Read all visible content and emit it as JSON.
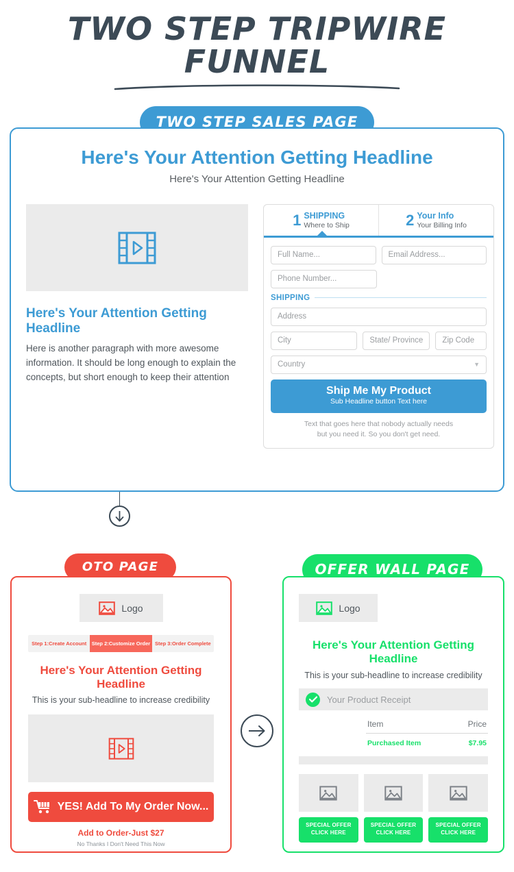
{
  "header": {
    "title": "TWO STEP TRIPWIRE FUNNEL",
    "badge": "TWO STEP SALES PAGE"
  },
  "sales_page": {
    "headline": "Here's Your Attention Getting Headline",
    "subheadline": "Here's Your Attention Getting Headline",
    "left": {
      "video_icon": "film-play-icon",
      "headline": "Here's Your Attention Getting Headline",
      "paragraph": "Here is another paragraph with more awesome information. It should be long enough to explain the concepts, but short enough to keep their attention"
    },
    "form": {
      "tabs": [
        {
          "number": "1",
          "title": "SHIPPING",
          "subtitle": "Where to Ship",
          "active": true
        },
        {
          "number": "2",
          "title": "Your Info",
          "subtitle": "Your Billing Info",
          "active": false
        }
      ],
      "fields": {
        "full_name": "Full Name...",
        "email": "Email Address...",
        "phone": "Phone Number...",
        "address": "Address",
        "city": "City",
        "state": "State/ Province",
        "zip": "Zip Code",
        "country": "Country"
      },
      "section_label": "SHIPPING",
      "submit": {
        "label": "Ship Me My Product",
        "sublabel": "Sub Headline button Text here"
      },
      "fineprint_line1": "Text that goes here that nobody actually needs",
      "fineprint_line2": "but you need it. So you don't get need."
    }
  },
  "connectors": {
    "down_arrow": "arrow-down-icon",
    "right_arrow": "arrow-right-icon"
  },
  "oto_page": {
    "badge": "OTO PAGE",
    "logo_label": "Logo",
    "logo_icon": "image-placeholder-icon",
    "steps": [
      {
        "label": "Step 1:Create Account",
        "active": false
      },
      {
        "label": "Step 2:Customize Order",
        "active": true
      },
      {
        "label": "Step 3:Order Complete",
        "active": false
      }
    ],
    "headline": "Here's Your Attention Getting Headline",
    "subheadline": "This is your sub-headline to increase credibility",
    "video_icon": "film-play-icon",
    "cta": {
      "icon": "shopping-cart-icon",
      "label": "YES! Add To My Order Now..."
    },
    "price_note": "Add to Order-Just $27",
    "decline_note": "No Thanks I Don't Need This Now"
  },
  "offer_wall_page": {
    "badge": "OFFER WALL PAGE",
    "logo_label": "Logo",
    "logo_icon": "image-placeholder-icon",
    "headline": "Here's Your Attention Getting Headline",
    "subheadline": "This is your sub-headline to increase credibility",
    "receipt": {
      "check_icon": "check-circle-icon",
      "label": "Your Product Receipt"
    },
    "table": {
      "columns": [
        "Item",
        "Price"
      ],
      "rows": [
        {
          "item": "Purchased Item",
          "price": "$7.95"
        }
      ]
    },
    "offers": [
      {
        "image_icon": "image-placeholder-icon",
        "line1": "SPECIAL OFFER",
        "line2": "CLICK HERE"
      },
      {
        "image_icon": "image-placeholder-icon",
        "line1": "SPECIAL OFFER",
        "line2": "CLICK HERE"
      },
      {
        "image_icon": "image-placeholder-icon",
        "line1": "SPECIAL OFFER",
        "line2": "CLICK HERE"
      }
    ]
  },
  "colors": {
    "blue": "#3d9bd4",
    "red": "#ef4b3e",
    "green": "#17e06a",
    "dark": "#3c4a56",
    "grey_panel": "#ebebeb"
  }
}
